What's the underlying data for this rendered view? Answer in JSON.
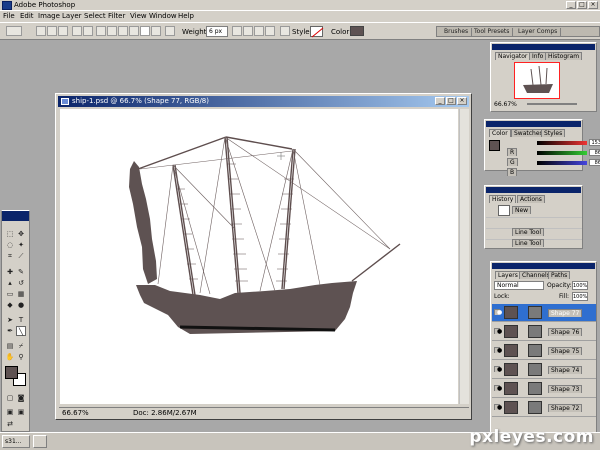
{
  "app": {
    "title": "Adobe Photoshop"
  },
  "menu": [
    "File",
    "Edit",
    "Image",
    "Layer",
    "Select",
    "Filter",
    "View",
    "Window",
    "Help"
  ],
  "options": {
    "weight_label": "Weight:",
    "weight_value": "6 px",
    "style_label": "Style:",
    "color_label": "Color:",
    "color": "#5e5252"
  },
  "dock_tabs": [
    "Brushes",
    "Tool Presets",
    "Layer Comps"
  ],
  "document": {
    "title": "ship-1.psd @ 66.7% (Shape 77, RGB/8)",
    "zoom": "66.67%",
    "info": "Doc: 2.86M/2.67M"
  },
  "navigator": {
    "tabs": [
      "Navigator",
      "Info",
      "Histogram"
    ],
    "zoom": "66.67%"
  },
  "color_panel": {
    "tabs": [
      "Color",
      "Swatches",
      "Styles"
    ],
    "channels": [
      {
        "label": "R",
        "value": "153",
        "color": "#cc3333"
      },
      {
        "label": "G",
        "value": "86",
        "color": "#33aa33"
      },
      {
        "label": "B",
        "value": "86",
        "color": "#3344cc"
      }
    ]
  },
  "history": {
    "tabs": [
      "History",
      "Actions"
    ],
    "items": [
      "New",
      "Line Tool",
      "Line Tool"
    ]
  },
  "layers": {
    "tabs": [
      "Layers",
      "Channels",
      "Paths"
    ],
    "blend_mode": "Normal",
    "opacity_label": "Opacity:",
    "opacity": "100%",
    "lock_label": "Lock:",
    "fill_label": "Fill:",
    "fill": "100%",
    "items": [
      "Shape 77",
      "Shape 76",
      "Shape 75",
      "Shape 74",
      "Shape 73",
      "Shape 72"
    ]
  },
  "taskbar": {
    "items": [
      "s31...",
      ""
    ]
  },
  "watermark": "pxleyes.com",
  "colors": {
    "fg": "#5e5252",
    "selection": "#2f6fd0",
    "titlebar": "#0a246a"
  }
}
